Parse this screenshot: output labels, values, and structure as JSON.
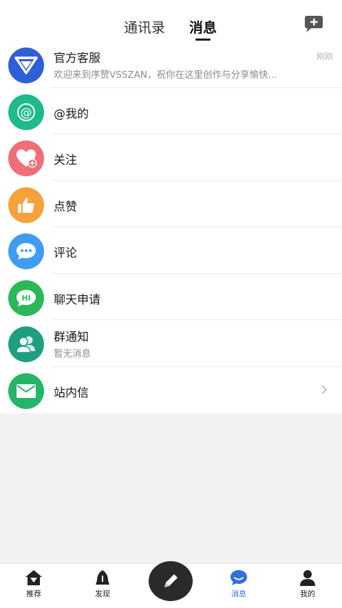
{
  "header": {
    "tabs": [
      {
        "label": "通讯录",
        "active": false
      },
      {
        "label": "消息",
        "active": true
      }
    ],
    "new_chat_icon": "chat-plus-icon"
  },
  "messages": {
    "items": [
      {
        "id": "official",
        "title": "官方客服",
        "subtitle": "欢迎来到序赞VSSZAN，祝你在这里创作与分享愉快...",
        "time": "刚刚",
        "icon": "vsszan-logo-icon",
        "color": "#2f5fd6"
      },
      {
        "id": "mentions",
        "title": "@我的",
        "icon": "at-icon",
        "color": "#1fba8c"
      },
      {
        "id": "follows",
        "title": "关注",
        "icon": "heart-plus-icon",
        "color": "#f06e77"
      },
      {
        "id": "likes",
        "title": "点赞",
        "icon": "thumbs-up-icon",
        "color": "#f5a23a"
      },
      {
        "id": "comments",
        "title": "评论",
        "icon": "comment-dots-icon",
        "color": "#3f9cf0"
      },
      {
        "id": "chat_requests",
        "title": "聊天申请",
        "icon": "hi-bubble-icon",
        "color": "#2cb858"
      },
      {
        "id": "group_notices",
        "title": "群通知",
        "subtitle": "暂无消息",
        "icon": "group-users-icon",
        "color": "#1f9e80"
      },
      {
        "id": "inbox",
        "title": "站内信",
        "icon": "envelope-icon",
        "color": "#24b568"
      }
    ]
  },
  "tabbar": {
    "items": [
      {
        "label": "推荐",
        "icon": "home-icon",
        "active": false
      },
      {
        "label": "发现",
        "icon": "discover-icon",
        "active": false
      },
      {
        "label": "消息",
        "icon": "message-icon",
        "active": true
      },
      {
        "label": "我的",
        "icon": "profile-icon",
        "active": false
      }
    ],
    "compose_icon": "pencil-icon",
    "active_color": "#2f6fe0"
  }
}
